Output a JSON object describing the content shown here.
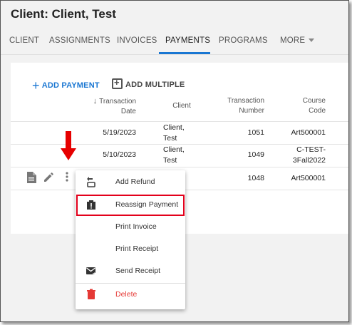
{
  "header": {
    "title": "Client: Client, Test"
  },
  "tabs": [
    {
      "label": "CLIENT"
    },
    {
      "label": "ASSIGNMENTS"
    },
    {
      "label": "INVOICES"
    },
    {
      "label": "PAYMENTS",
      "active": true
    },
    {
      "label": "PROGRAMS"
    },
    {
      "label": "MORE"
    }
  ],
  "toolbar": {
    "add_payment": "ADD PAYMENT",
    "add_multiple": "ADD MULTIPLE"
  },
  "table": {
    "columns": [
      "Transaction Date",
      "Client",
      "Transaction Number",
      "Course Code"
    ],
    "column_lines": {
      "date": [
        "Transaction",
        "Date"
      ],
      "number": [
        "Transaction",
        "Number"
      ],
      "course": [
        "Course",
        "Code"
      ]
    },
    "sort_icon": "arrow-down-icon",
    "rows": [
      {
        "date": "5/19/2023",
        "client": [
          "Client,",
          "Test"
        ],
        "number": "1051",
        "course": [
          "Art500001"
        ]
      },
      {
        "date": "5/10/2023",
        "client": [
          "Client,",
          "Test"
        ],
        "number": "1049",
        "course": [
          "C-TEST-",
          "3Fall2022"
        ]
      },
      {
        "date": "",
        "client": [
          "",
          ""
        ],
        "number": "1048",
        "course": [
          "Art500001"
        ]
      }
    ]
  },
  "menu": {
    "items": [
      {
        "label": "Add Refund",
        "icon": "refund-icon"
      },
      {
        "label": "Reassign Payment",
        "icon": "reassign-icon",
        "highlighted": true
      },
      {
        "label": "Print Invoice",
        "icon": ""
      },
      {
        "label": "Print Receipt",
        "icon": ""
      },
      {
        "label": "Send Receipt",
        "icon": "send-mail-icon"
      },
      {
        "label": "Delete",
        "icon": "trash-icon"
      }
    ]
  },
  "colors": {
    "accent": "#1976d2",
    "danger": "#e53935",
    "highlight_border": "#e3001b",
    "callout_arrow": "#e60000"
  }
}
